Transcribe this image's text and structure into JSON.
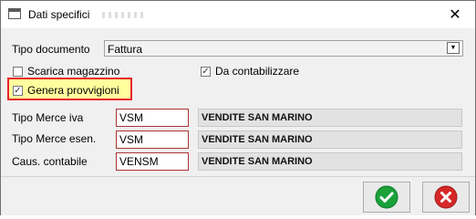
{
  "window": {
    "title": "Dati specifici",
    "close_label": "✕"
  },
  "form": {
    "tipo_documento": {
      "label": "Tipo documento",
      "value": "Fattura"
    },
    "checkboxes": {
      "scarica_magazzino": {
        "label": "Scarica magazzino",
        "checked": false
      },
      "da_contabilizzare": {
        "label": "Da contabilizzare",
        "checked": true
      },
      "genera_provvigioni": {
        "label": "Genera provvigioni",
        "checked": true
      }
    },
    "rows": [
      {
        "label": "Tipo Merce iva",
        "code": "VSM",
        "description": "VENDITE SAN MARINO"
      },
      {
        "label": "Tipo Merce esen.",
        "code": "VSM",
        "description": "VENDITE SAN MARINO"
      },
      {
        "label": "Caus. contabile",
        "code": "VENSM",
        "description": "VENDITE SAN MARINO"
      }
    ]
  },
  "colors": {
    "confirm": "#1aa13a",
    "cancel": "#d62828",
    "highlight_border": "#e8222a",
    "highlight_fill": "#ffff9e"
  },
  "icons": {
    "confirm": "check-circle-icon",
    "cancel": "x-circle-icon",
    "dropdown": "chevron-down-icon"
  }
}
